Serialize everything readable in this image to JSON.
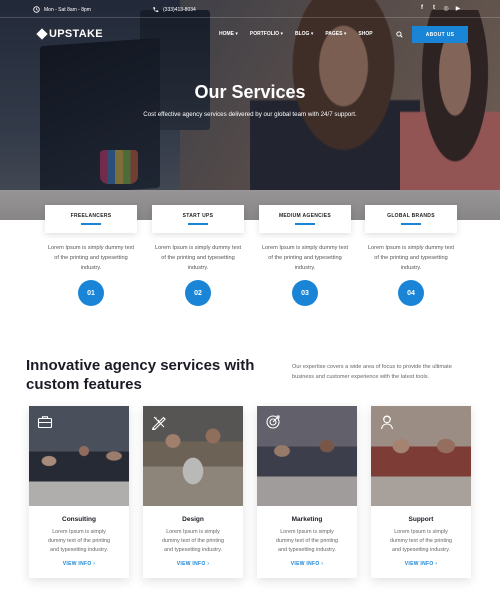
{
  "topbar": {
    "hours": "Mon - Sat 8am - 8pm",
    "phone": "(333)413-8034",
    "social": [
      {
        "name": "facebook",
        "glyph": "f"
      },
      {
        "name": "twitter",
        "glyph": "t"
      },
      {
        "name": "instagram",
        "glyph": "◎"
      },
      {
        "name": "youtube",
        "glyph": "▶"
      }
    ]
  },
  "nav": {
    "logo": "UPSTAKE",
    "items": [
      "HOME",
      "PORTFOLIO",
      "BLOG",
      "PAGES",
      "SHOP"
    ],
    "cta": "ABOUT US"
  },
  "hero": {
    "title": "Our Services",
    "subtitle": "Cost effective agency services delivered by our global team with 24/7 support."
  },
  "features": [
    {
      "label": "FREELANCERS",
      "desc": "Lorem Ipsum is simply dummy text of the printing and typesetting industry.",
      "num": "01"
    },
    {
      "label": "START UPS",
      "desc": "Lorem Ipsum is simply dummy text of the printing and typesetting industry.",
      "num": "02"
    },
    {
      "label": "MEDIUM AGENCIES",
      "desc": "Lorem Ipsum is simply dummy text of the printing and typesetting industry.",
      "num": "03"
    },
    {
      "label": "GLOBAL BRANDS",
      "desc": "Lorem Ipsum is simply dummy text of the printing and typesetting industry.",
      "num": "04"
    }
  ],
  "section": {
    "title": "Innovative agency services with custom features",
    "desc": "Our expertise covers a wide area of focus to provide the ultimate business and customer experience with the latest tools."
  },
  "cards": [
    {
      "title": "Consulting",
      "body": "Lorem Ipsum is simply dummy text of the printing and typesetting industry.",
      "more": "VIEW INFO ›",
      "icon": "briefcase-icon"
    },
    {
      "title": "Design",
      "body": "Lorem Ipsum is simply dummy text of the printing and typesetting industry.",
      "more": "VIEW INFO ›",
      "icon": "pencil-ruler-icon"
    },
    {
      "title": "Marketing",
      "body": "Lorem Ipsum is simply dummy text of the printing and typesetting industry.",
      "more": "VIEW INFO ›",
      "icon": "target-icon"
    },
    {
      "title": "Support",
      "body": "Lorem Ipsum is simply dummy text of the printing and typesetting industry.",
      "more": "VIEW INFO ›",
      "icon": "user-support-icon"
    }
  ],
  "colors": {
    "accent": "#1a85d6",
    "heading": "#1b1b26",
    "text": "#666666"
  }
}
